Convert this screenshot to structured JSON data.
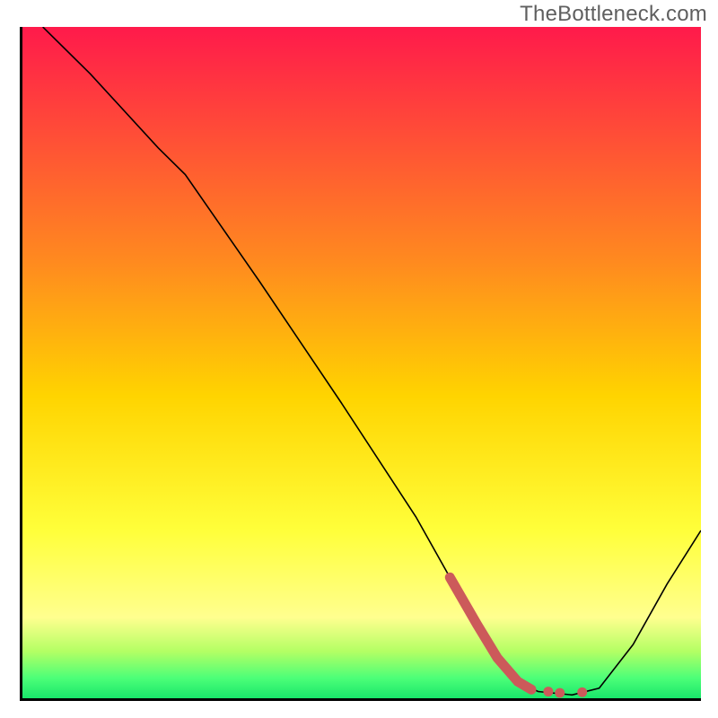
{
  "watermark": "TheBottleneck.com",
  "chart_data": {
    "type": "line",
    "title": "",
    "xlabel": "",
    "ylabel": "",
    "xlim": [
      0,
      100
    ],
    "ylim": [
      0,
      100
    ],
    "grid": false,
    "legend": false,
    "gradient_steps": [
      {
        "y_pct": 0,
        "color": "#ff1a4b"
      },
      {
        "y_pct": 35,
        "color": "#ff8a1f"
      },
      {
        "y_pct": 55,
        "color": "#ffd400"
      },
      {
        "y_pct": 75,
        "color": "#ffff3a"
      },
      {
        "y_pct": 88,
        "color": "#ffff8f"
      },
      {
        "y_pct": 93,
        "color": "#b4ff64"
      },
      {
        "y_pct": 97,
        "color": "#4cff78"
      },
      {
        "y_pct": 100,
        "color": "#19e66a"
      }
    ],
    "series": [
      {
        "name": "bottleneck-curve",
        "stroke": "#000000",
        "stroke_width": 1.6,
        "points": [
          {
            "x": 3,
            "y": 100
          },
          {
            "x": 10,
            "y": 93
          },
          {
            "x": 20,
            "y": 82
          },
          {
            "x": 24,
            "y": 78
          },
          {
            "x": 35,
            "y": 62
          },
          {
            "x": 47,
            "y": 44
          },
          {
            "x": 58,
            "y": 27
          },
          {
            "x": 63,
            "y": 18
          },
          {
            "x": 67,
            "y": 11
          },
          {
            "x": 70,
            "y": 6
          },
          {
            "x": 73,
            "y": 2.5
          },
          {
            "x": 76,
            "y": 1
          },
          {
            "x": 81,
            "y": 0.5
          },
          {
            "x": 85,
            "y": 1.5
          },
          {
            "x": 90,
            "y": 8
          },
          {
            "x": 95,
            "y": 17
          },
          {
            "x": 100,
            "y": 25
          }
        ]
      },
      {
        "name": "optimal-segment",
        "stroke": "#cc5a5a",
        "stroke_width": 11,
        "linecap": "round",
        "points": [
          {
            "x": 63,
            "y": 18
          },
          {
            "x": 67,
            "y": 11
          },
          {
            "x": 70,
            "y": 6
          },
          {
            "x": 73,
            "y": 2.5
          },
          {
            "x": 75,
            "y": 1.3
          }
        ]
      }
    ],
    "dots": {
      "stroke": "#cc5a5a",
      "radius": 5.5,
      "points": [
        {
          "x": 77.5,
          "y": 1
        },
        {
          "x": 79.2,
          "y": 0.8
        },
        {
          "x": 82.5,
          "y": 0.9
        }
      ]
    }
  }
}
